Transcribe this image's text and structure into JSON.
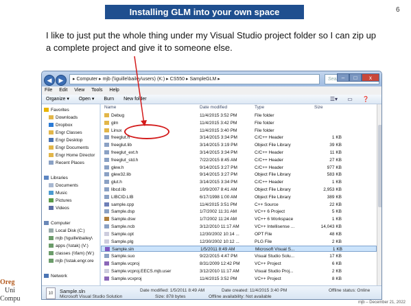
{
  "slide": {
    "title": "Installing GLM into your own space",
    "number": "6",
    "body": "I like to just put the whole thing under my Visual Studio project folder so I can zip up a complete project and give it to someone else.",
    "footer_left1": "Oreg",
    "footer_left2": "Uni",
    "footer_left3": "Compu",
    "footer_right": "mjb – December 21, 2022"
  },
  "window": {
    "address": "▸ Computer ▸ mjb (\\\\guille\\bailey\\users) (K:) ▸ CS550 ▸ SampleGLM ▸",
    "search_placeholder": "Search SampleGLM",
    "menu": [
      "File",
      "Edit",
      "View",
      "Tools",
      "Help"
    ],
    "toolbar": [
      "Organize ▾",
      "Open ▾",
      "Burn",
      "New folder"
    ],
    "min_label": "–",
    "max_label": "□",
    "close_label": "x",
    "back_label": "◀",
    "fwd_label": "▶"
  },
  "nav": [
    {
      "label": "Favorites",
      "icon": "star-icon",
      "color": "#e8b400"
    },
    {
      "label": "Downloads",
      "icon": "folder-icon",
      "color": "#e2b649"
    },
    {
      "label": "Dropbox",
      "icon": "dropbox-icon",
      "color": "#2b7bd6"
    },
    {
      "label": "Engr Classes",
      "icon": "folder-icon",
      "color": "#e2b649"
    },
    {
      "label": "Engr Desktop",
      "icon": "folder-icon",
      "color": "#4a74b4"
    },
    {
      "label": "Engr Documents",
      "icon": "folder-icon",
      "color": "#e2b649"
    },
    {
      "label": "Engr Home Director",
      "icon": "folder-icon",
      "color": "#e2b649"
    },
    {
      "label": "Recent Places",
      "icon": "recent-icon",
      "color": "#8aa1c4"
    },
    {
      "label": "",
      "icon": "",
      "color": ""
    },
    {
      "label": "Libraries",
      "icon": "library-icon",
      "color": "#5d86c2"
    },
    {
      "label": "Documents",
      "icon": "documents-icon",
      "color": "#a7b7d0"
    },
    {
      "label": "Music",
      "icon": "music-icon",
      "color": "#4b9bd1"
    },
    {
      "label": "Pictures",
      "icon": "pictures-icon",
      "color": "#5a9a48"
    },
    {
      "label": "Videos",
      "icon": "videos-icon",
      "color": "#5c6fa5"
    },
    {
      "label": "",
      "icon": "",
      "color": ""
    },
    {
      "label": "Computer",
      "icon": "computer-icon",
      "color": "#6a87b7"
    },
    {
      "label": "Local Disk (C:)",
      "icon": "drive-icon",
      "color": "#9aa"
    },
    {
      "label": "mjb (\\\\guille\\bailey\\",
      "icon": "network-drive-icon",
      "color": "#6b9c6a"
    },
    {
      "label": "apps (\\\\stak) (V:)",
      "icon": "network-drive-icon",
      "color": "#6b9c6a"
    },
    {
      "label": "classes (\\\\fam) (W:)",
      "icon": "network-drive-icon",
      "color": "#6b9c6a"
    },
    {
      "label": "mjb (\\\\stak.engr.ore",
      "icon": "network-drive-icon",
      "color": "#6b9c6a"
    },
    {
      "label": "",
      "icon": "",
      "color": ""
    },
    {
      "label": "Network",
      "icon": "network-icon",
      "color": "#4a74b4"
    }
  ],
  "columns": [
    "Name",
    "Date modified",
    "Type",
    "Size"
  ],
  "files": [
    {
      "name": "Debug",
      "date": "11/4/2015 3:52 PM",
      "type": "File folder",
      "size": "",
      "icon": "folder-icon",
      "color": "#e2b649"
    },
    {
      "name": "glm",
      "date": "11/4/2015 3:42 PM",
      "type": "File folder",
      "size": "",
      "icon": "folder-icon",
      "color": "#e2b649"
    },
    {
      "name": "Linux",
      "date": "11/4/2015 3:40 PM",
      "type": "File folder",
      "size": "",
      "icon": "folder-icon",
      "color": "#e2b649"
    },
    {
      "name": "freeglut.h",
      "date": "3/14/2015 3:34 PM",
      "type": "C/C++ Header",
      "size": "1 KB",
      "icon": "header-icon",
      "color": "#8aa1c4"
    },
    {
      "name": "freeglut.lib",
      "date": "3/14/2015 3:19 PM",
      "type": "Object File Library",
      "size": "39 KB",
      "icon": "lib-icon",
      "color": "#8aa1c4"
    },
    {
      "name": "freeglut_ext.h",
      "date": "3/14/2015 3:34 PM",
      "type": "C/C++ Header",
      "size": "11 KB",
      "icon": "header-icon",
      "color": "#8aa1c4"
    },
    {
      "name": "freeglut_std.h",
      "date": "7/22/2015 8:45 AM",
      "type": "C/C++ Header",
      "size": "27 KB",
      "icon": "header-icon",
      "color": "#8aa1c4"
    },
    {
      "name": "glew.h",
      "date": "9/14/2015 3:27 PM",
      "type": "C/C++ Header",
      "size": "977 KB",
      "icon": "header-icon",
      "color": "#8aa1c4"
    },
    {
      "name": "glew32.lib",
      "date": "9/14/2015 3:27 PM",
      "type": "Object File Library",
      "size": "583 KB",
      "icon": "lib-icon",
      "color": "#8aa1c4"
    },
    {
      "name": "glut.h",
      "date": "3/14/2015 3:34 PM",
      "type": "C/C++ Header",
      "size": "1 KB",
      "icon": "header-icon",
      "color": "#8aa1c4"
    },
    {
      "name": "libcd.lib",
      "date": "10/9/2007 8:41 AM",
      "type": "Object File Library",
      "size": "2,953 KB",
      "icon": "lib-icon",
      "color": "#8aa1c4"
    },
    {
      "name": "LIBCID.LIB",
      "date": "6/17/1998 1:00 AM",
      "type": "Object File Library",
      "size": "389 KB",
      "icon": "lib-icon",
      "color": "#8aa1c4"
    },
    {
      "name": "sample.cpp",
      "date": "11/4/2015 3:51 PM",
      "type": "C++ Source",
      "size": "22 KB",
      "icon": "cpp-icon",
      "color": "#6d7fb8"
    },
    {
      "name": "Sample.dsp",
      "date": "1/7/2002 11:31 AM",
      "type": "VC++ 6 Project",
      "size": "5 KB",
      "icon": "project-icon",
      "color": "#8aa1c4"
    },
    {
      "name": "Sample.dsw",
      "date": "1/7/2002 11:24 AM",
      "type": "VC++ 6 Workspace",
      "size": "1 KB",
      "icon": "workspace-icon",
      "color": "#b0803c"
    },
    {
      "name": "Sample.ncb",
      "date": "3/12/2010 11:17 AM",
      "type": "VC++ Intellisense ...",
      "size": "14,043 KB",
      "icon": "ncb-icon",
      "color": "#8aa1c4"
    },
    {
      "name": "Sample.opt",
      "date": "12/30/2002 10:14 ...",
      "type": "OPT File",
      "size": "48 KB",
      "icon": "file-icon",
      "color": "#ccd"
    },
    {
      "name": "Sample.plg",
      "date": "12/30/2002 10:12 ...",
      "type": "PLG File",
      "size": "2 KB",
      "icon": "file-icon",
      "color": "#ccd"
    },
    {
      "name": "Sample.sln",
      "date": "1/5/2011 8:49 AM",
      "type": "Microsoft Visual S...",
      "size": "1 KB",
      "icon": "sln-icon",
      "color": "#7e57c2",
      "selected": true
    },
    {
      "name": "Sample.suo",
      "date": "9/22/2015 4:47 PM",
      "type": "Visual Studio Solu...",
      "size": "17 KB",
      "icon": "suo-icon",
      "color": "#8aa1c4"
    },
    {
      "name": "Sample.vcproj",
      "date": "8/31/2009 12:42 PM",
      "type": "VC++ Project",
      "size": "6 KB",
      "icon": "vcproj-icon",
      "color": "#8a67b8"
    },
    {
      "name": "Sample.vcproj.EECS.mjb.user",
      "date": "3/12/2010 11:17 AM",
      "type": "Visual Studio Proj...",
      "size": "2 KB",
      "icon": "file-icon",
      "color": "#ccd"
    },
    {
      "name": "Sample.vcxproj",
      "date": "11/4/2015 3:52 PM",
      "type": "VC++ Project",
      "size": "8 KB",
      "icon": "vcproj-icon",
      "color": "#8a67b8"
    }
  ],
  "details": {
    "name": "Sample.sln",
    "kind": "Microsoft Visual Studio Solution",
    "date_modified": "Date modified: 1/5/2011 8:49 AM",
    "size": "Size: 878 bytes",
    "date_created": "Date created: 11/4/2015 3:40 PM",
    "offline_avail": "Offline availability: Not available",
    "offline_status": "Offline status: Online",
    "icon_num": "10"
  },
  "colors": {
    "title_bg": "#1f4f8f",
    "highlight": "#d31a1a",
    "selection": "#cbe3fb"
  }
}
